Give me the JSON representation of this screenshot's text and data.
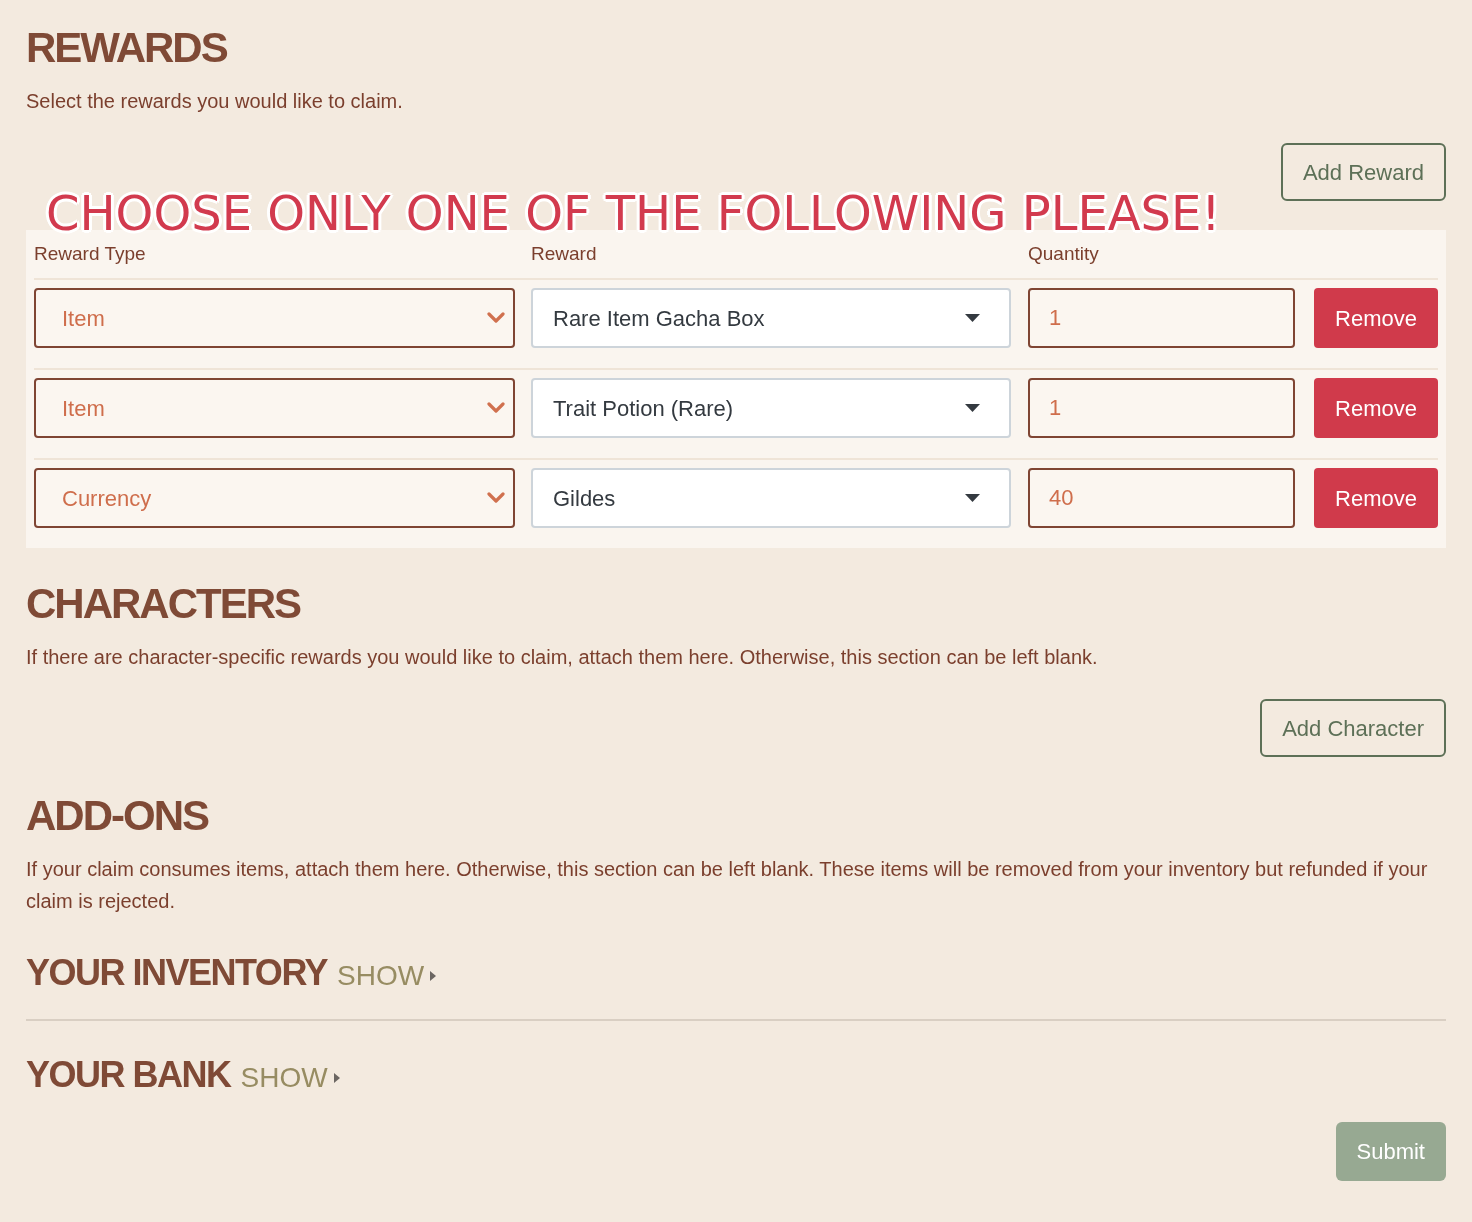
{
  "rewards": {
    "heading": "REWARDS",
    "description": "Select the rewards you would like to claim.",
    "add_button": "Add Reward",
    "notice": "CHOOSE ONLY ONE OF THE FOLLOWING PLEASE!",
    "columns": [
      "Reward Type",
      "Reward",
      "Quantity"
    ],
    "rows": [
      {
        "reward_type": "Item",
        "reward": "Rare Item Gacha Box",
        "quantity": "1",
        "remove_button": "Remove"
      },
      {
        "reward_type": "Item",
        "reward": "Trait Potion (Rare)",
        "quantity": "1",
        "remove_button": "Remove"
      },
      {
        "reward_type": "Currency",
        "reward": "Gildes",
        "quantity": "40",
        "remove_button": "Remove"
      }
    ]
  },
  "characters": {
    "heading": "CHARACTERS",
    "description": "If there are character-specific rewards you would like to claim, attach them here. Otherwise, this section can be left blank.",
    "add_button": "Add Character"
  },
  "addons": {
    "heading": "ADD-ONS",
    "description": "If your claim consumes items, attach them here. Otherwise, this section can be left blank. These items will be removed from your inventory but refunded if your claim is rejected.",
    "panels": [
      {
        "title": "YOUR INVENTORY",
        "toggle": "SHOW",
        "expanded": false
      },
      {
        "title": "YOUR BANK",
        "toggle": "SHOW",
        "expanded": false
      }
    ]
  },
  "submit_button": "Submit"
}
